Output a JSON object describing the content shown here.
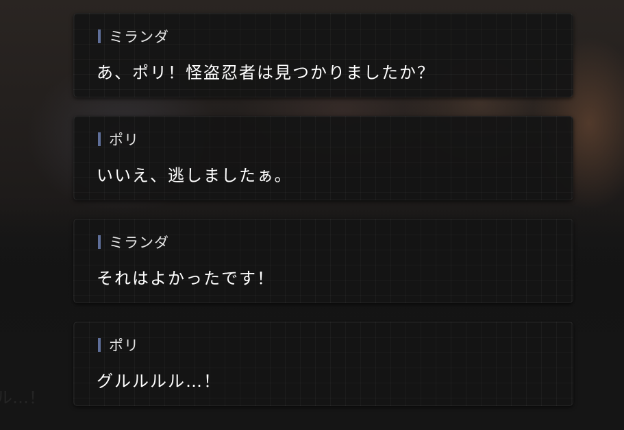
{
  "ghost_text": "ル…！",
  "entries": [
    {
      "speaker": "ミランダ",
      "text": "あ、ポリ！怪盗忍者は見つかりましたか？"
    },
    {
      "speaker": "ポリ",
      "text": "いいえ、逃しましたぁ。"
    },
    {
      "speaker": "ミランダ",
      "text": "それはよかったです！"
    },
    {
      "speaker": "ポリ",
      "text": "グルルルル…！"
    }
  ]
}
